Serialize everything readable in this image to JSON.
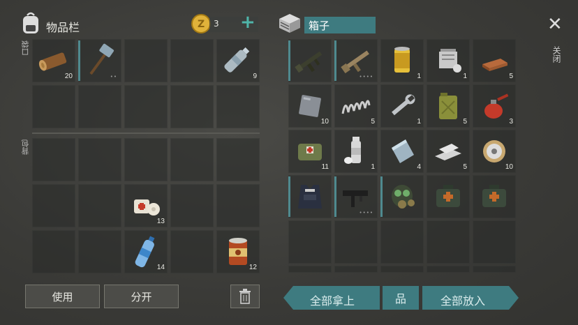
{
  "inventory": {
    "title": "物品栏",
    "coin_count": "3",
    "plus_symbol": "+",
    "pocket_label": "口袋",
    "backpack_label": "背包",
    "pocket_slots": [
      {
        "icon": "log-icon",
        "qty": "20"
      },
      {
        "icon": "sledgehammer-icon",
        "qty": "",
        "stars": "••"
      },
      {
        "icon": "",
        "qty": ""
      },
      {
        "icon": "",
        "qty": ""
      },
      {
        "icon": "water-bottle-icon",
        "qty": "9"
      }
    ],
    "backpack_items": [
      {
        "icon": "bandage-icon",
        "qty": "13"
      },
      {
        "icon": "water-bottle-icon",
        "qty": "14"
      },
      {
        "icon": "canned-food-icon",
        "qty": "12"
      }
    ],
    "use_label": "使用",
    "split_label": "分开"
  },
  "chest": {
    "title": "箱子",
    "close_symbol": "✕",
    "close_label": "关闭",
    "items": [
      {
        "icon": "assault-rifle-icon",
        "qty": ""
      },
      {
        "icon": "tan-rifle-icon",
        "qty": "",
        "stars": "••••"
      },
      {
        "icon": "oil-filter-icon",
        "qty": "1"
      },
      {
        "icon": "engine-part-icon",
        "qty": "1"
      },
      {
        "icon": "copper-ingot-icon",
        "qty": "5"
      },
      {
        "icon": "metal-plate-icon",
        "qty": "10"
      },
      {
        "icon": "spring-icon",
        "qty": "5"
      },
      {
        "icon": "wrench-icon",
        "qty": "1"
      },
      {
        "icon": "jerrycan-icon",
        "qty": "5"
      },
      {
        "icon": "oil-can-icon",
        "qty": "3"
      },
      {
        "icon": "medkit-bag-icon",
        "qty": "11"
      },
      {
        "icon": "spray-paint-icon",
        "qty": "1"
      },
      {
        "icon": "glass-sheet-icon",
        "qty": "4"
      },
      {
        "icon": "aluminum-bar-icon",
        "qty": "5"
      },
      {
        "icon": "wire-spool-icon",
        "qty": "10"
      },
      {
        "icon": "police-vest-icon",
        "qty": ""
      },
      {
        "icon": "smg-icon",
        "qty": "",
        "stars": "••••"
      },
      {
        "icon": "gas-mask-icon",
        "qty": ""
      },
      {
        "icon": "first-aid-kit-icon",
        "qty": ""
      },
      {
        "icon": "first-aid-kit-icon",
        "qty": ""
      }
    ],
    "take_all_label": "全部拿上",
    "sort_symbol": "品",
    "put_all_label": "全部放入"
  },
  "colors": {
    "teal": "#3e7b80",
    "coin": "#e0b23a"
  }
}
